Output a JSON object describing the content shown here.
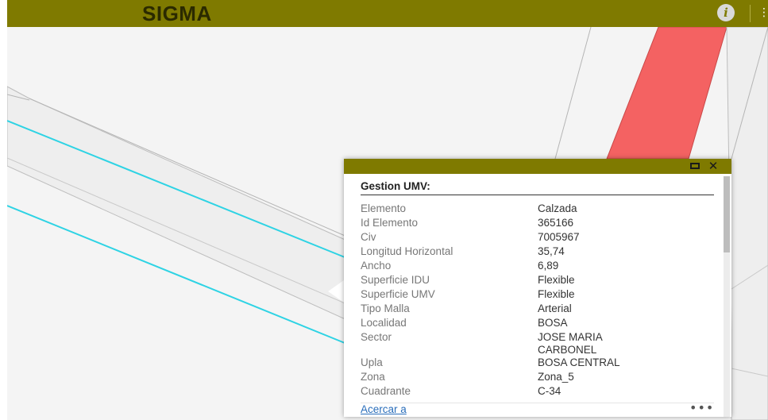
{
  "app": {
    "title": "SIGMA",
    "info_label": "i",
    "more_label": "⋮"
  },
  "colors": {
    "toolbar": "#7f7a00",
    "road_fill": "#f46262",
    "road_line": "#2ed3e4"
  },
  "popup": {
    "title": "Gestion UMV:",
    "close_label": "✕",
    "attributes": [
      {
        "label": "Elemento",
        "value": "Calzada"
      },
      {
        "label": "Id Elemento",
        "value": "365166"
      },
      {
        "label": "Civ",
        "value": "7005967"
      },
      {
        "label": "Longitud Horizontal",
        "value": "35,74"
      },
      {
        "label": "Ancho",
        "value": "6,89"
      },
      {
        "label": "Superficie IDU",
        "value": "Flexible"
      },
      {
        "label": "Superficie UMV",
        "value": "Flexible"
      },
      {
        "label": "Tipo Malla",
        "value": "Arterial"
      },
      {
        "label": "Localidad",
        "value": "BOSA"
      },
      {
        "label": "Sector",
        "value": "JOSE MARIA CARBONEL"
      },
      {
        "label": "Upla",
        "value": "BOSA CENTRAL"
      },
      {
        "label": "Zona",
        "value": "Zona_5"
      },
      {
        "label": "Cuadrante",
        "value": "C-34"
      }
    ],
    "zoom_link": "Acercar a",
    "more_label": "•••"
  }
}
